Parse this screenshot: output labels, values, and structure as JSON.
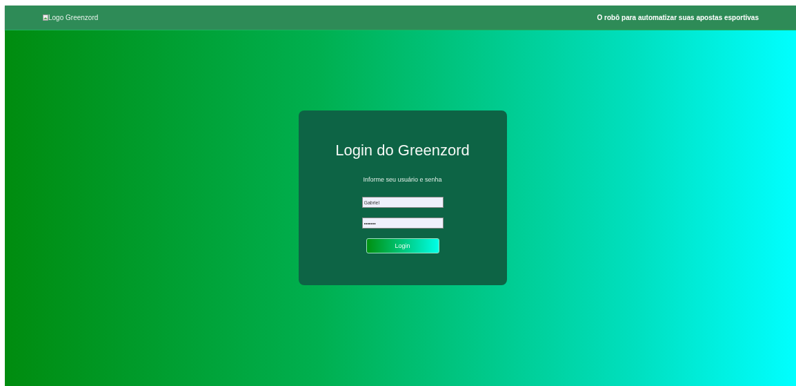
{
  "header": {
    "logo_alt": "Logo Greenzord",
    "tagline": "O robô para automatizar suas apostas esportivas"
  },
  "login": {
    "title": "Login do Greenzord",
    "subtitle": "Informe seu usuário e senha",
    "username": "Gabriel",
    "password": "•••••••",
    "button": "Login"
  }
}
